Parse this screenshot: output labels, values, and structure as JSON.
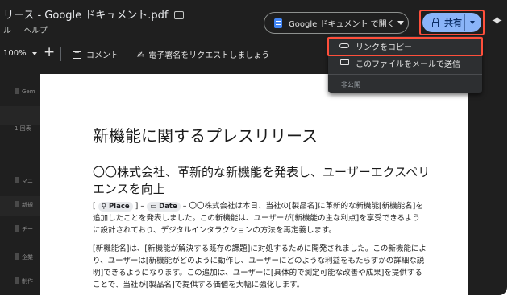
{
  "window": {
    "title": "リース - Google ドキュメント.pdf",
    "menu": [
      "ル",
      "ヘルプ"
    ]
  },
  "header": {
    "open_with_label": "Google ドキュメント で開く",
    "share_label": "共有"
  },
  "toolbar": {
    "zoom": "100%",
    "comment_label": "コメント",
    "esign_label": "電子署名をリクエストしましょう"
  },
  "share_menu": {
    "copy_link": "リンクをコピー",
    "email_file": "このファイルをメールで送信",
    "visibility": "非公開"
  },
  "sidebar": {
    "rows": [
      "Gem",
      "1 回表",
      "マニ",
      "新規",
      "チー",
      "企業",
      "制作"
    ]
  },
  "document": {
    "title": "新機能に関するプレスリリース",
    "subtitle": "〇〇株式会社、革新的な新機能を発表し、ユーザーエクスペリエンスを向上",
    "chip_place": "Place",
    "chip_date": "Date",
    "para1_bracket": "[",
    "para1_mid": " ] – ",
    "para1_rest": " – 〇〇株式会社は本日、当社の[製品名]に革新的な新機能[新機能名]を追加したことを発表しました。この新機能は、ユーザーが[新機能の主な利点]を享受できるように設計されており、デジタルインタラクションの方法を再定義します。",
    "para2": "[新機能名]は、[新機能が解決する既存の課題]に対処するために開発されました。この新機能により、ユーザーは[新機能がどのように動作し、ユーザーにどのような利益をもたらすかの詳細な説明]できるようになります。この追加は、ユーザーに[具体的で測定可能な改善や成果]を提供することで、当社が[製品名]で提供する価値を大幅に強化します。"
  },
  "colors": {
    "highlight": "#ff4f3b",
    "share_button": "#8ab4f8",
    "background": "#1f1f1f"
  }
}
